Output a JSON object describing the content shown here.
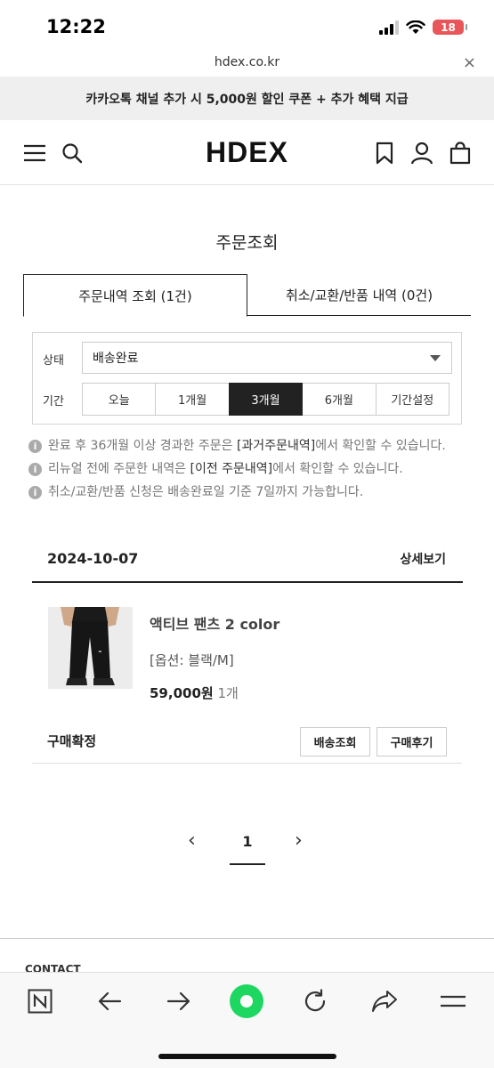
{
  "status_bar": {
    "time": "12:22",
    "battery": "18"
  },
  "browser": {
    "url": "hdex.co.kr",
    "close_symbol": "×"
  },
  "promo": {
    "text": "카카오톡 채널 추가 시 5,000원 할인 쿠폰 + 추가 혜택 지급"
  },
  "header": {
    "logo": "HDEX"
  },
  "page": {
    "title": "주문조회"
  },
  "tabs": [
    {
      "label": "주문내역 조회 (1건)",
      "active": true
    },
    {
      "label": "취소/교환/반품 내역 (0건)",
      "active": false
    }
  ],
  "filter": {
    "status_label": "상태",
    "status_value": "배송완료",
    "period_label": "기간",
    "periods": [
      "오늘",
      "1개월",
      "3개월",
      "6개월",
      "기간설정"
    ],
    "selected_period": "3개월"
  },
  "notices": [
    {
      "before": "완료 후 36개월 이상 경과한 주문은 ",
      "link": "[과거주문내역]",
      "after": "에서 확인할 수 있습니다."
    },
    {
      "before": "리뉴얼 전에 주문한 내역은 ",
      "link": "[이전 주문내역]",
      "after": "에서 확인할 수 있습니다."
    },
    {
      "before": "취소/교환/반품 신청은 배송완료일 기준 7일까지 가능합니다.",
      "link": "",
      "after": ""
    }
  ],
  "order": {
    "date": "2024-10-07",
    "detail_label": "상세보기",
    "product": {
      "name": "액티브 팬츠 2 color",
      "option": "[옵션: 블랙/M]",
      "price": "59,000",
      "currency": "원",
      "quantity": "1개"
    },
    "status_label": "구매확정",
    "buttons": {
      "track": "배송조회",
      "review": "구매후기"
    }
  },
  "pagination": {
    "prev": "‹",
    "current": "1",
    "next": "›"
  },
  "footer": {
    "peek": "CONTACT"
  },
  "colors": {
    "accent_green": "#1ed760",
    "battery_red": "#e8565a",
    "selected_period_bg": "#222222"
  }
}
